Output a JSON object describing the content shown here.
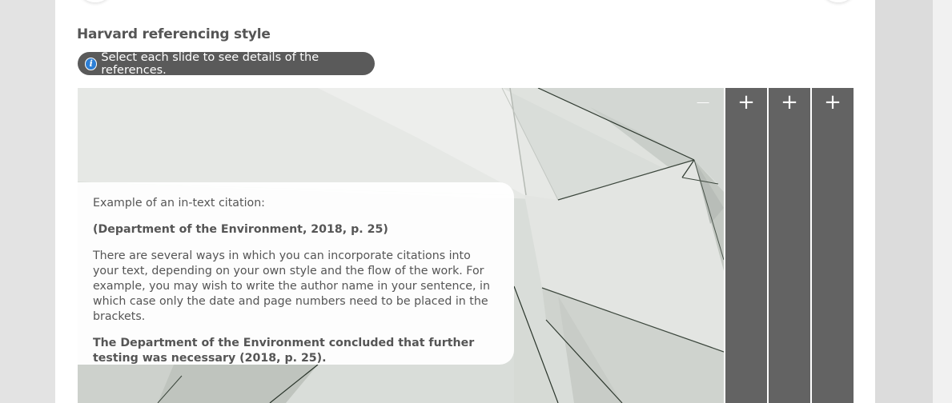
{
  "section": {
    "title": "Harvard referencing style",
    "instruction": "Select each slide to see details of the references."
  },
  "icons": {
    "info": "info-icon",
    "collapse": "minus-icon",
    "expand": "plus-icon"
  },
  "slide": {
    "intro": "Example of an in-text citation:",
    "citation": "(Department of the Environment, 2018, p. 25)",
    "explanation": "There are several ways in which you can incorporate citations into your text, depending on your own style and the flow of the work. For example, you may wish to write the author name in your sentence, in which case only the date and page numbers need to be placed in the brackets.",
    "example": "The Department of the Environment concluded that further testing was necessary (2018, p. 25)."
  },
  "controls": {
    "collapse_symbol": "−",
    "expand_symbol": "+"
  },
  "colors": {
    "tab_background": "#636363",
    "pill_background": "#5a5a5a",
    "info_icon": "#2d7fd6",
    "text": "#555555"
  }
}
